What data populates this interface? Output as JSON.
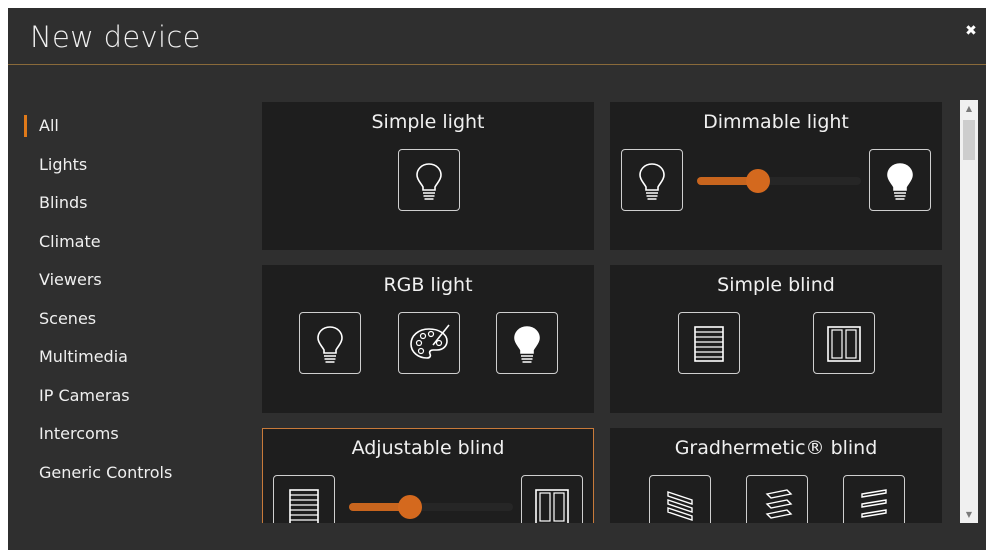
{
  "dialog": {
    "title": "New device",
    "close_glyph": "✖"
  },
  "sidebar": {
    "items": [
      {
        "label": "All",
        "active": true
      },
      {
        "label": "Lights"
      },
      {
        "label": "Blinds"
      },
      {
        "label": "Climate"
      },
      {
        "label": "Viewers"
      },
      {
        "label": "Scenes"
      },
      {
        "label": "Multimedia"
      },
      {
        "label": "IP Cameras"
      },
      {
        "label": "Intercoms"
      },
      {
        "label": "Generic Controls"
      }
    ]
  },
  "cards": [
    {
      "title": "Simple light"
    },
    {
      "title": "Dimmable light",
      "slider_value": 0.37
    },
    {
      "title": "RGB light"
    },
    {
      "title": "Simple blind"
    },
    {
      "title": "Adjustable blind",
      "slider_value": 0.37,
      "selected": true
    },
    {
      "title": "Gradhermetic® blind"
    }
  ],
  "colors": {
    "accent": "#e07a1a",
    "background": "#2f2f2f",
    "card": "#1e1e1e"
  }
}
